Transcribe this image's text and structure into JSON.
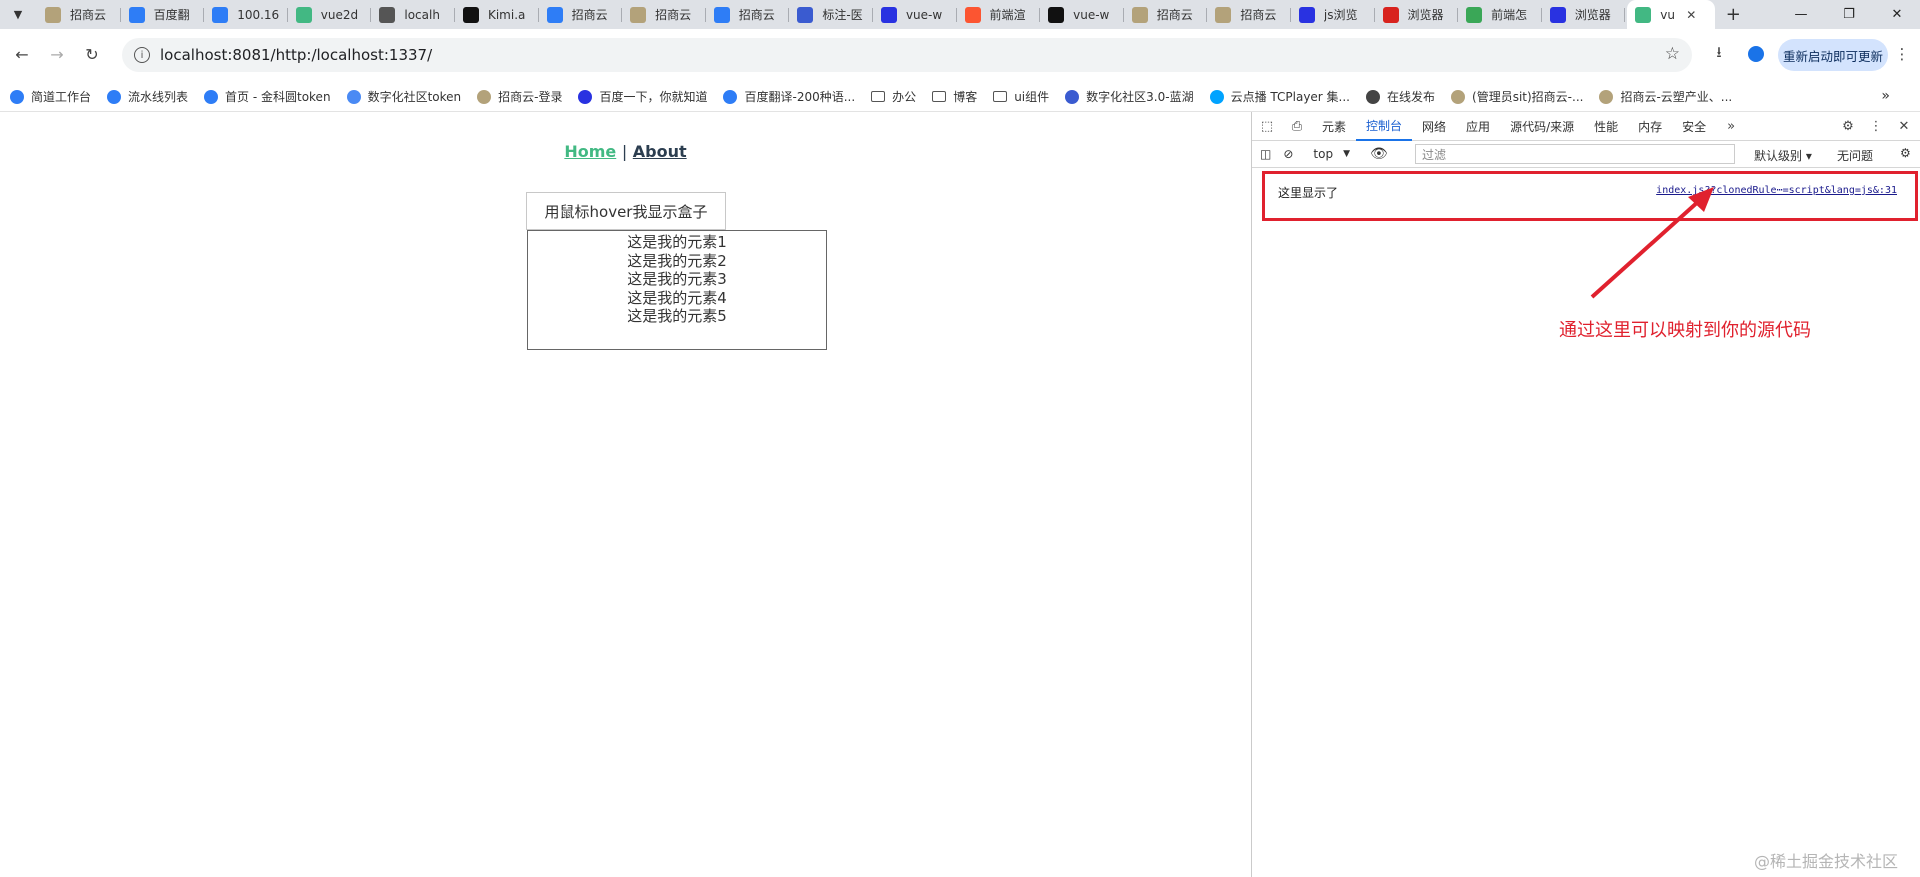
{
  "tabs": [
    {
      "title": "招商云",
      "icon": "zhaoshang-icon",
      "color": "#b3a27a"
    },
    {
      "title": "百度翻",
      "icon": "translate-icon",
      "color": "#2e7df6"
    },
    {
      "title": "100.16",
      "icon": "loading-icon",
      "color": "#2e7df6"
    },
    {
      "title": "vue2d",
      "icon": "vue-icon",
      "color": "#42b883"
    },
    {
      "title": "localh",
      "icon": "globe-icon",
      "color": "#555555"
    },
    {
      "title": "Kimi.a",
      "icon": "kimi-icon",
      "color": "#111111"
    },
    {
      "title": "招商云",
      "icon": "feather-icon",
      "color": "#2e7df6"
    },
    {
      "title": "招商云",
      "icon": "zhaoshang-icon",
      "color": "#b3a27a"
    },
    {
      "title": "招商云",
      "icon": "feather-icon",
      "color": "#2e7df6"
    },
    {
      "title": "标注-医",
      "icon": "flask-icon",
      "color": "#3a5bd0"
    },
    {
      "title": "vue-w",
      "icon": "baidu-paw-icon",
      "color": "#2932e1"
    },
    {
      "title": "前端渲",
      "icon": "csdn-icon",
      "color": "#fc5531"
    },
    {
      "title": "vue-w",
      "icon": "github-icon",
      "color": "#111111"
    },
    {
      "title": "招商云",
      "icon": "zhaoshang-icon",
      "color": "#b3a27a"
    },
    {
      "title": "招商云",
      "icon": "zhaoshang-icon",
      "color": "#b3a27a"
    },
    {
      "title": "js浏览",
      "icon": "baidu-paw-icon",
      "color": "#2932e1"
    },
    {
      "title": "浏览器",
      "icon": "51-icon",
      "color": "#d8231e"
    },
    {
      "title": "前端怎",
      "icon": "notes-icon",
      "color": "#3aa757"
    },
    {
      "title": "浏览器",
      "icon": "baidu-paw-icon",
      "color": "#2932e1"
    }
  ],
  "active_tab": {
    "title": "vu",
    "icon": "vue-icon",
    "color": "#42b883"
  },
  "address": {
    "url": "localhost:8081/http:/localhost:1337/"
  },
  "update_button": "重新启动即可更新",
  "bookmarks": [
    {
      "label": "简道工作台",
      "type": "link",
      "color": "#2e7df6"
    },
    {
      "label": "流水线列表",
      "type": "link",
      "color": "#2e7df6"
    },
    {
      "label": "首页 - 金科圆token",
      "type": "link",
      "color": "#2e7df6"
    },
    {
      "label": "数字化社区token",
      "type": "link",
      "color": "#4a8af4"
    },
    {
      "label": "招商云-登录",
      "type": "link",
      "color": "#b3a27a"
    },
    {
      "label": "百度一下，你就知道",
      "type": "link",
      "color": "#2932e1"
    },
    {
      "label": "百度翻译-200种语...",
      "type": "link",
      "color": "#2e7df6"
    },
    {
      "label": "办公",
      "type": "folder",
      "color": "#555555"
    },
    {
      "label": "博客",
      "type": "folder",
      "color": "#555555"
    },
    {
      "label": "ui组件",
      "type": "folder",
      "color": "#555555"
    },
    {
      "label": "数字化社区3.0-蓝湖",
      "type": "link",
      "color": "#3a5bd0"
    },
    {
      "label": "云点播 TCPlayer 集...",
      "type": "link",
      "color": "#00a3ff"
    },
    {
      "label": "在线发布",
      "type": "link",
      "color": "#444444"
    },
    {
      "label": "(管理员sit)招商云-...",
      "type": "link",
      "color": "#b3a27a"
    },
    {
      "label": "招商云-云塑产业、...",
      "type": "link",
      "color": "#b3a27a"
    }
  ],
  "page": {
    "nav_home": "Home",
    "nav_sep": "|",
    "nav_about": "About",
    "hover_button": "用鼠标hover我显示盒子",
    "items": [
      "这是我的元素1",
      "这是我的元素2",
      "这是我的元素3",
      "这是我的元素4",
      "这是我的元素5"
    ]
  },
  "devtools": {
    "tabs": [
      "元素",
      "控制台",
      "网络",
      "应用",
      "源代码/来源",
      "性能",
      "内存",
      "安全"
    ],
    "active_tab": "控制台",
    "context": "top",
    "filter_placeholder": "过滤",
    "levels": "默认级别",
    "issues": "无问题",
    "log_message": "这里显示了",
    "log_source": "index.js??clonedRule⋯=script&lang=js&:31"
  },
  "annotation": "通过这里可以映射到你的源代码",
  "watermark": "@稀土掘金技术社区",
  "colors": {
    "accent_red": "#e0212e",
    "vue_green": "#42b983",
    "devtools_blue": "#1a73e8"
  }
}
